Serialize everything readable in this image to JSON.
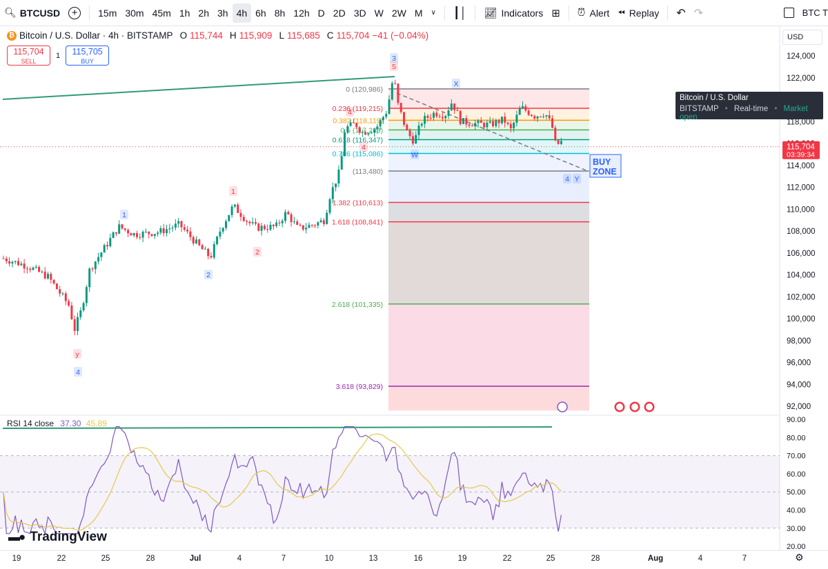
{
  "toolbar": {
    "symbol": "BTCUSD",
    "intervals": [
      "15m",
      "30m",
      "45m",
      "1h",
      "2h",
      "3h",
      "4h",
      "6h",
      "8h",
      "12h",
      "D",
      "2D",
      "3D",
      "W",
      "2W",
      "M"
    ],
    "active_interval": "4h",
    "indicators_label": "Indicators",
    "alert_label": "Alert",
    "replay_label": "Replay",
    "right_symbol": "BTC T"
  },
  "legend": {
    "title": "Bitcoin / U.S. Dollar · 4h · BITSTAMP",
    "o_label": "O",
    "o": "115,744",
    "h_label": "H",
    "h": "115,909",
    "l_label": "L",
    "l": "115,685",
    "c_label": "C",
    "c": "115,704",
    "change": "−41 (−0.04%)"
  },
  "quote": {
    "sell_price": "115,704",
    "sell_label": "SELL",
    "spread": "1",
    "buy_price": "115,705",
    "buy_label": "BUY"
  },
  "tooltip": {
    "title": "Bitcoin / U.S. Dollar",
    "exchange": "BITSTAMP",
    "realtime": "Real-time",
    "status": "Market open"
  },
  "currency": "USD",
  "price_axis": {
    "labels": [
      "124,000",
      "122,000",
      "120,000",
      "118,000",
      "116,000",
      "114,000",
      "112,000",
      "110,000",
      "108,000",
      "106,000",
      "104,000",
      "102,000",
      "100,000",
      "98,000",
      "96,000",
      "94,000",
      "92,000"
    ],
    "current_price": "115,704",
    "countdown": "03:39:34"
  },
  "fib_levels": [
    {
      "label": "0 (120,986)",
      "price": 120986,
      "color": "#787b86"
    },
    {
      "label": "0.236 (119,215)",
      "price": 119215,
      "color": "#f23645"
    },
    {
      "label": "0.382 (118,119)",
      "price": 118119,
      "color": "#ff9800"
    },
    {
      "label": "0.5 (117,233)",
      "price": 117233,
      "color": "#4caf50"
    },
    {
      "label": "0.618 (116,347)",
      "price": 116347,
      "color": "#089981"
    },
    {
      "label": "0.786 (115,086)",
      "price": 115086,
      "color": "#00bcd4"
    },
    {
      "label": "(113,480)",
      "price": 113480,
      "color": "#787b86"
    },
    {
      "label": "1.382 (110,613)",
      "price": 110613,
      "color": "#f23645"
    },
    {
      "label": "1.618 (108,841)",
      "price": 108841,
      "color": "#f23645"
    },
    {
      "label": "2.618 (101,335)",
      "price": 101335,
      "color": "#4caf50"
    },
    {
      "label": "3.618 (93,829)",
      "price": 93829,
      "color": "#9c27b0"
    }
  ],
  "wave_labels": [
    "3",
    "5",
    "X",
    "W",
    "4",
    "Y",
    "4",
    "y",
    "1",
    "2",
    "1",
    "2",
    "4",
    "4"
  ],
  "buy_zone": [
    "BUY",
    "ZONE"
  ],
  "rsi": {
    "title": "RSI 14 close",
    "value": "37.30",
    "ma_value": "45.89",
    "axis": [
      "90.00",
      "80.00",
      "70.00",
      "60.00",
      "50.00",
      "40.00",
      "30.00",
      "20.00"
    ]
  },
  "time_axis": [
    "19",
    "22",
    "25",
    "28",
    "Jul",
    "4",
    "7",
    "10",
    "13",
    "16",
    "19",
    "22",
    "25",
    "28",
    "Aug",
    "4",
    "7"
  ],
  "branding": "TradingView",
  "colors": {
    "up": "#089981",
    "down": "#f23645",
    "rsi": "#7e57c2",
    "rsi_ma": "#e6c84a",
    "trend": "#2e9a7a"
  }
}
